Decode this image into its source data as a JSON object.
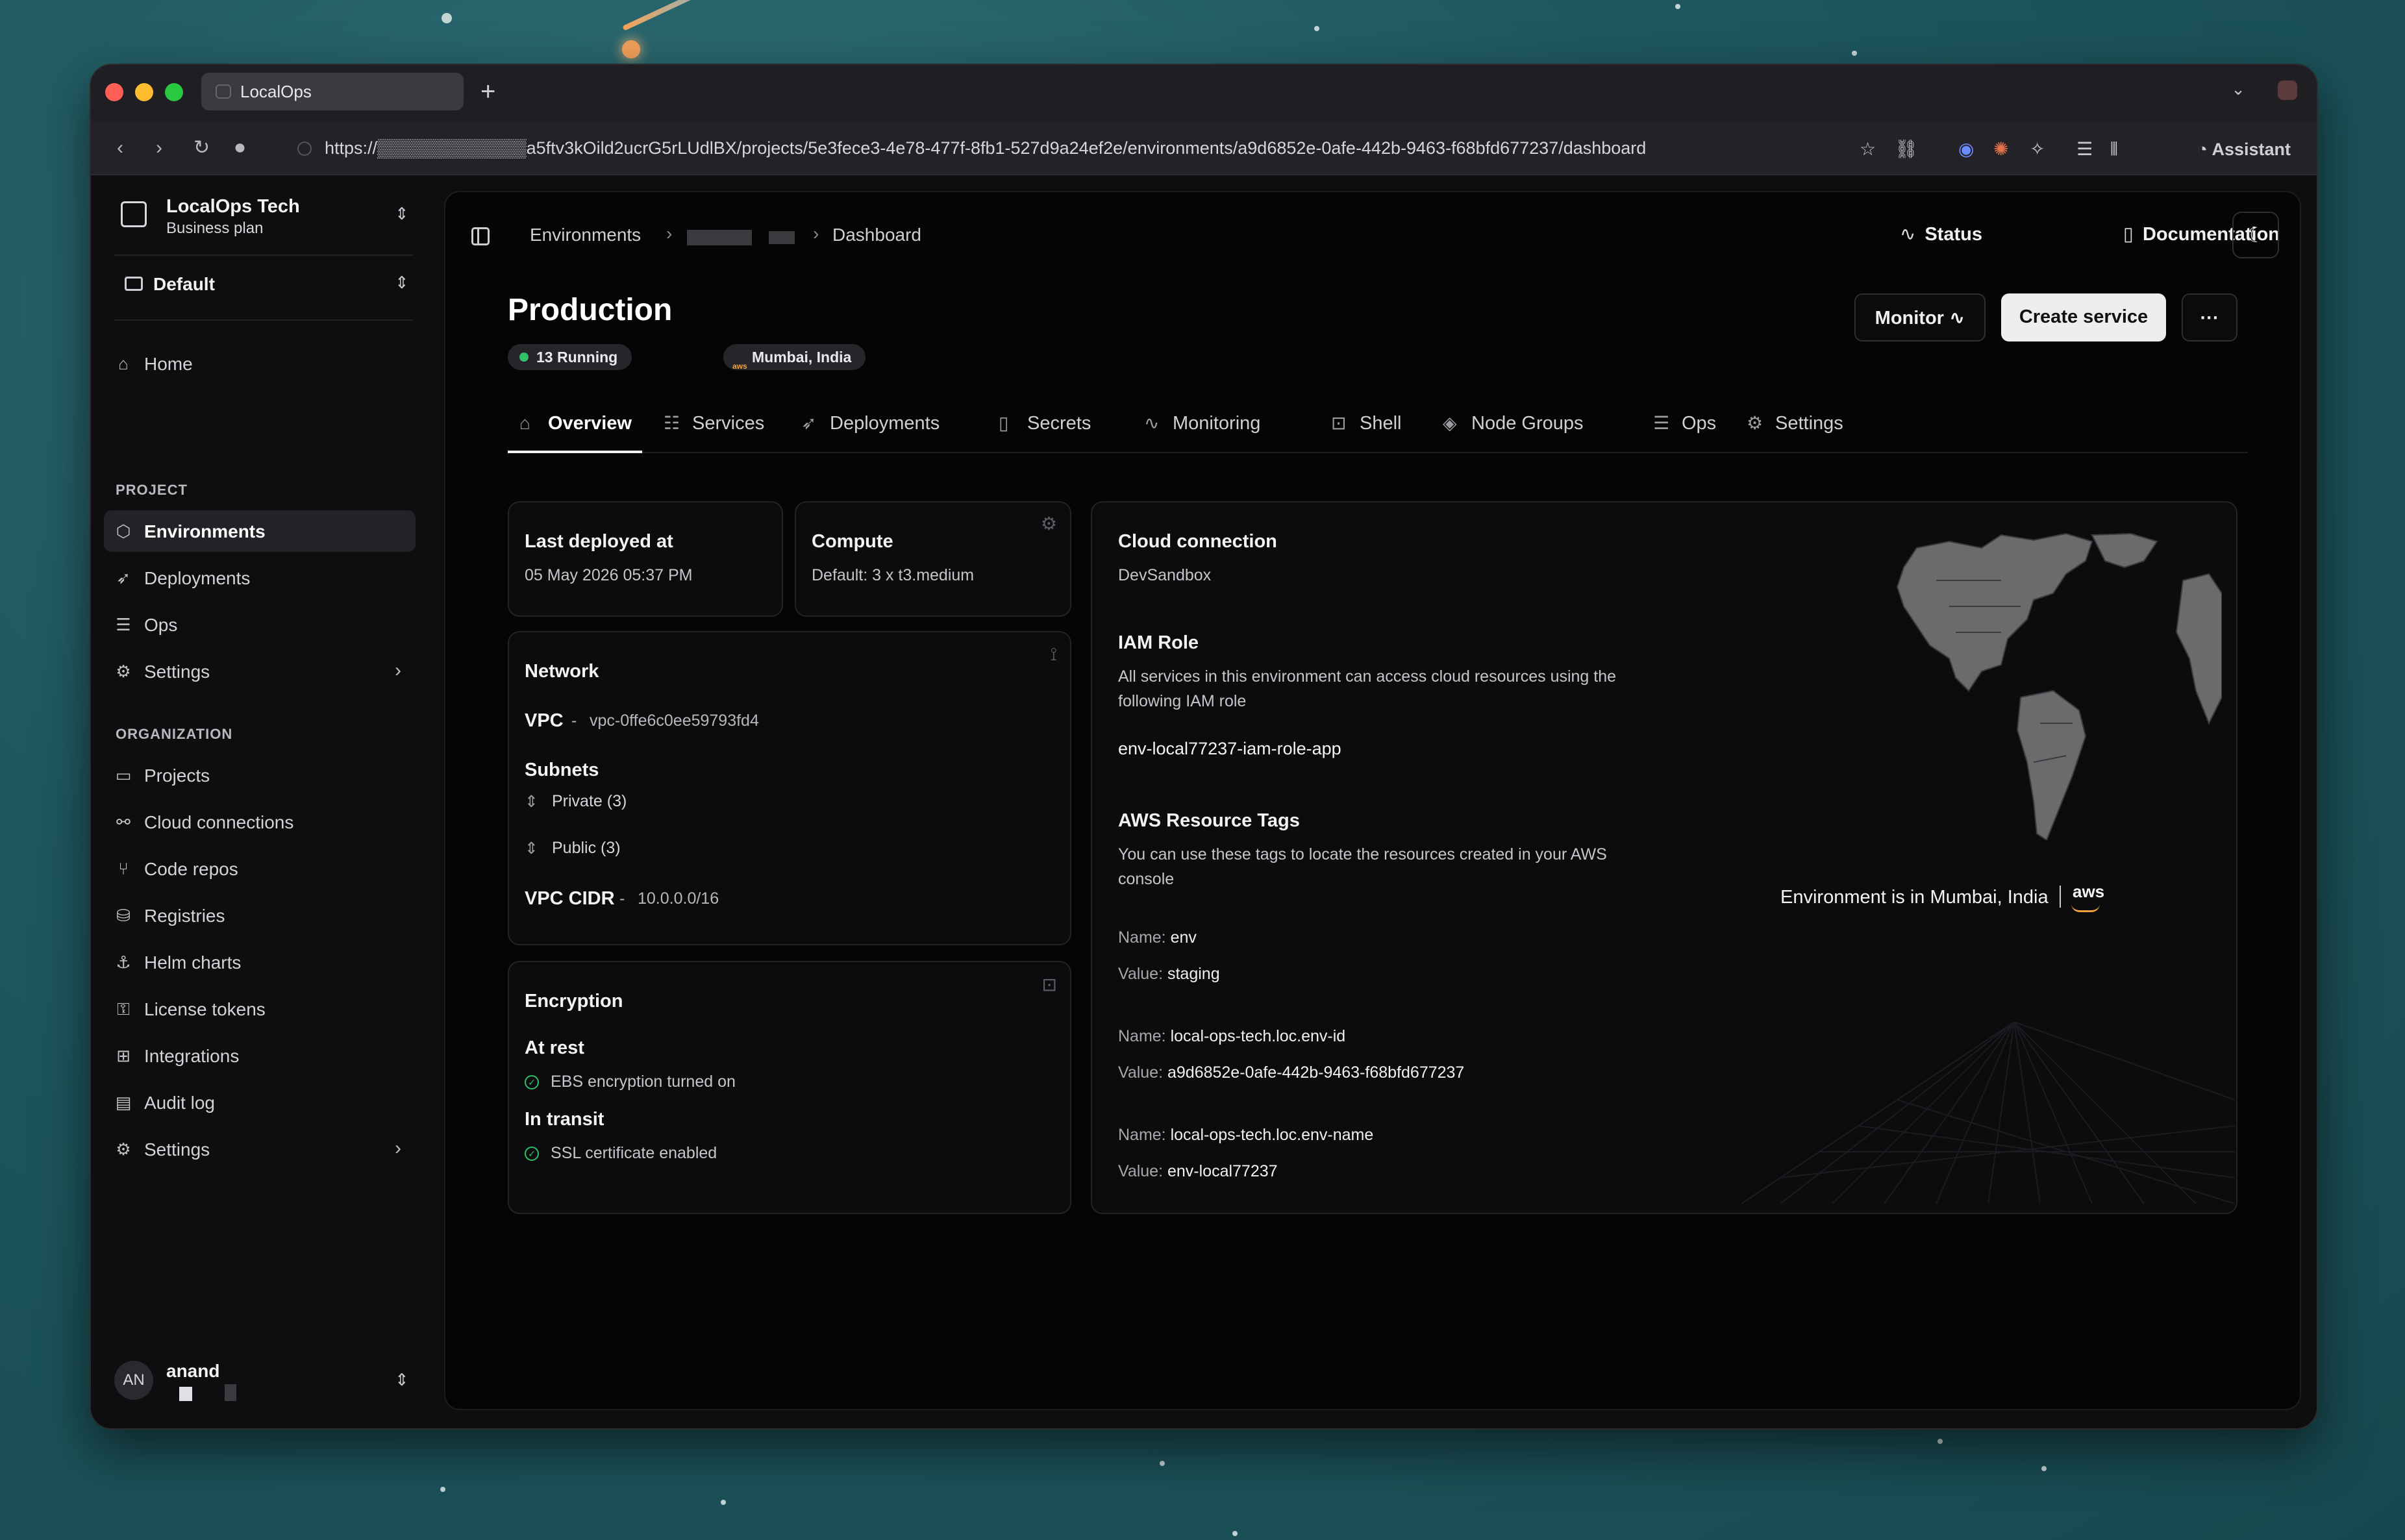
{
  "browser": {
    "tab_title": "LocalOps",
    "url": "https://▒▒▒▒▒▒▒▒▒▒▒▒a5ftv3kOild2ucrG5rLUdlBX/projects/5e3fece3-4e78-477f-8fb1-527d9a24ef2e/environments/a9d6852e-0afe-442b-9463-f68bfd677237/dashboard",
    "assistant_label": "Assistant"
  },
  "sidebar": {
    "org_name": "LocalOps Tech",
    "org_plan": "Business plan",
    "project_name": "Default",
    "home": "Home",
    "project_section": "PROJECT",
    "project_items": [
      {
        "label": "Environments",
        "icon": "cube-icon"
      },
      {
        "label": "Deployments",
        "icon": "rocket-icon"
      },
      {
        "label": "Ops",
        "icon": "list-icon"
      },
      {
        "label": "Settings",
        "icon": "gear-icon"
      }
    ],
    "org_section": "ORGANIZATION",
    "org_items": [
      {
        "label": "Projects",
        "icon": "folder-icon"
      },
      {
        "label": "Cloud connections",
        "icon": "cloud-link-icon"
      },
      {
        "label": "Code repos",
        "icon": "git-branch-icon"
      },
      {
        "label": "Registries",
        "icon": "database-icon"
      },
      {
        "label": "Helm charts",
        "icon": "anchor-icon"
      },
      {
        "label": "License tokens",
        "icon": "key-icon"
      },
      {
        "label": "Integrations",
        "icon": "blocks-icon"
      },
      {
        "label": "Audit log",
        "icon": "scroll-icon"
      },
      {
        "label": "Settings",
        "icon": "gear-icon"
      }
    ],
    "user_initials": "AN",
    "user_name": "anand"
  },
  "header": {
    "breadcrumb_root": "Environments",
    "breadcrumb_current": "Dashboard",
    "status_link": "Status",
    "docs_link": "Documentation"
  },
  "environment": {
    "title": "Production",
    "running_badge": "13 Running",
    "region_badge": "Mumbai, India",
    "monitor_button": "Monitor",
    "create_button": "Create service",
    "more_button": "···"
  },
  "tabs": [
    "Overview",
    "Services",
    "Deployments",
    "Secrets",
    "Monitoring",
    "Shell",
    "Node Groups",
    "Ops",
    "Settings"
  ],
  "cards": {
    "last_deployed": {
      "title": "Last deployed at",
      "value": "05 May 2026 05:37 PM"
    },
    "compute": {
      "title": "Compute",
      "value": "Default: 3 x t3.medium"
    },
    "network": {
      "title": "Network",
      "vpc_label": "VPC",
      "vpc_value": "vpc-0ffe6c0ee59793fd4",
      "subnets_label": "Subnets",
      "private": "Private (3)",
      "public": "Public (3)",
      "cidr_label": "VPC CIDR",
      "cidr_value": "10.0.0.0/16",
      "sep": "-"
    },
    "encryption": {
      "title": "Encryption",
      "at_rest_label": "At rest",
      "at_rest_value": "EBS encryption turned on",
      "in_transit_label": "In transit",
      "in_transit_value": "SSL certificate enabled"
    },
    "cloud": {
      "title": "Cloud connection",
      "connection": "DevSandbox",
      "iam_title": "IAM Role",
      "iam_desc_1": "All services in this environment can access cloud resources using the",
      "iam_desc_2": "following IAM role",
      "iam_role": "env-local77237-iam-role-app",
      "tags_title": "AWS Resource Tags",
      "tags_desc_1": "You can use these tags to locate the resources created in your AWS",
      "tags_desc_2": "console",
      "name_label": "Name:",
      "value_label": "Value:",
      "tags": [
        {
          "name": "env",
          "value": "staging"
        },
        {
          "name": "local-ops-tech.loc.env-id",
          "value": "a9d6852e-0afe-442b-9463-f68bfd677237"
        },
        {
          "name": "local-ops-tech.loc.env-name",
          "value": "env-local77237"
        }
      ],
      "location_text": "Environment is in Mumbai, India",
      "provider_logo": "aws"
    }
  }
}
